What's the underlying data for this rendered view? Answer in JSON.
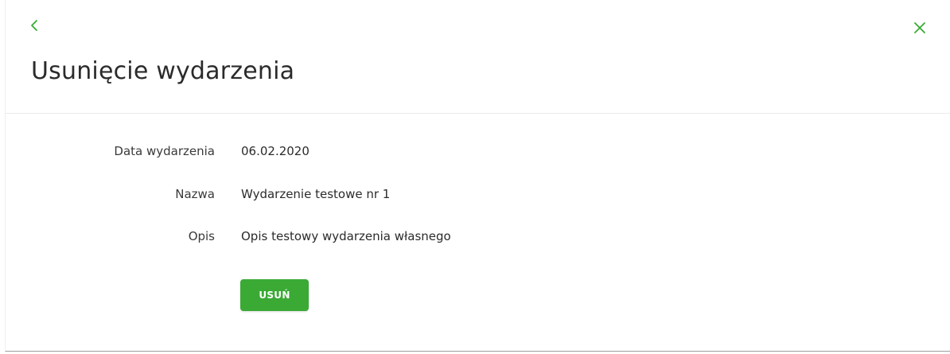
{
  "header": {
    "back_icon": "chevron-left-icon",
    "close_icon": "close-icon",
    "title": "Usunięcie wydarzenia"
  },
  "details": {
    "rows": [
      {
        "label": "Data wydarzenia",
        "value": "06.02.2020"
      },
      {
        "label": "Nazwa",
        "value": "Wydarzenie testowe nr 1"
      },
      {
        "label": "Opis",
        "value": "Opis testowy wydarzenia własnego"
      }
    ]
  },
  "actions": {
    "delete_label": "USUŃ"
  },
  "colors": {
    "accent": "#3aaa35",
    "text": "#2b2b2b",
    "divider": "#ececec"
  }
}
